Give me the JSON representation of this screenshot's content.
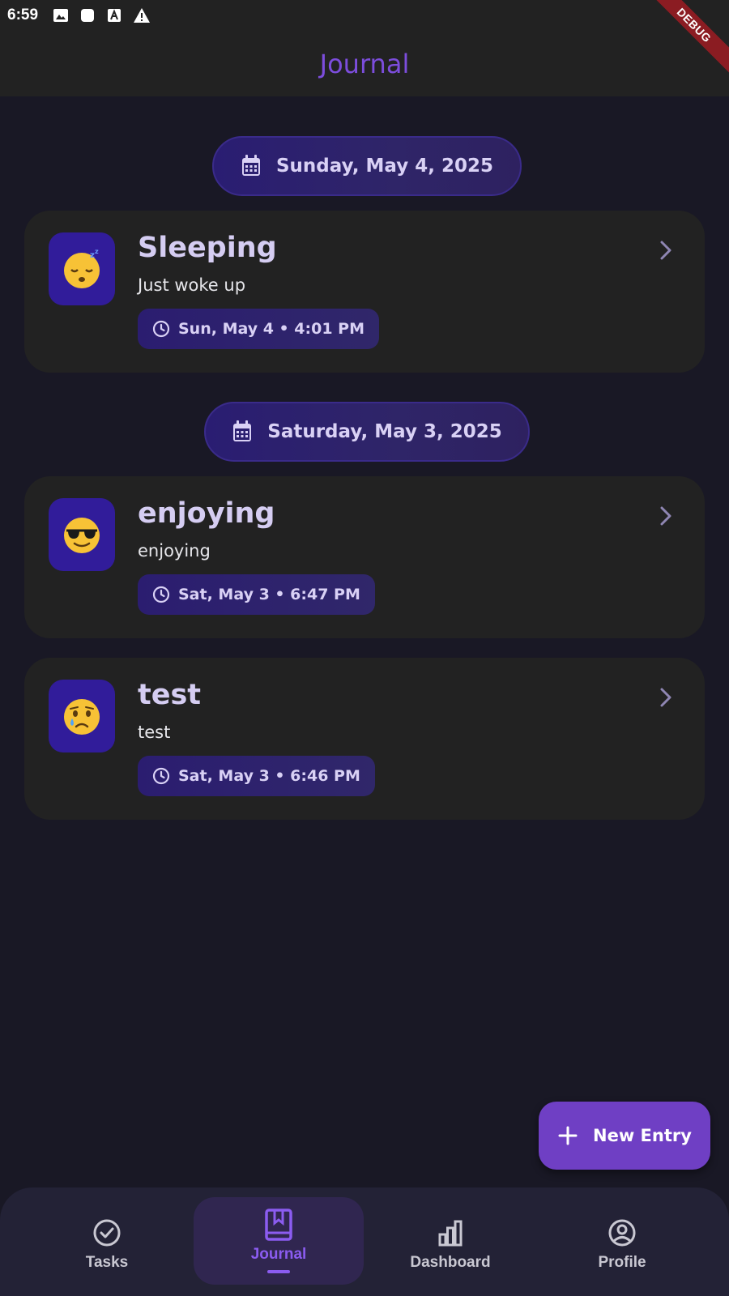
{
  "status_bar": {
    "time": "6:59"
  },
  "debug_banner": "DEBUG",
  "app_bar": {
    "title": "Journal"
  },
  "groups": [
    {
      "date_label": "Sunday, May 4, 2025",
      "entries": [
        {
          "emoji": "sleeping-face",
          "title": "Sleeping",
          "description": "Just woke up",
          "timestamp": "Sun, May 4 • 4:01 PM"
        }
      ]
    },
    {
      "date_label": "Saturday, May 3, 2025",
      "entries": [
        {
          "emoji": "smiling-face-with-sunglasses",
          "title": "enjoying",
          "description": "enjoying",
          "timestamp": "Sat, May 3 • 6:47 PM"
        },
        {
          "emoji": "crying-face",
          "title": "test",
          "description": "test",
          "timestamp": "Sat, May 3 • 6:46 PM"
        }
      ]
    }
  ],
  "fab": {
    "label": "New Entry"
  },
  "bottom_nav": {
    "items": [
      {
        "label": "Tasks",
        "icon": "check-circle-icon"
      },
      {
        "label": "Journal",
        "icon": "journal-bookmark-icon",
        "active": true
      },
      {
        "label": "Dashboard",
        "icon": "bar-chart-icon"
      },
      {
        "label": "Profile",
        "icon": "account-circle-icon"
      }
    ]
  },
  "colors": {
    "accent": "#7c4ddc",
    "background": "#191825",
    "card": "#222222",
    "fab": "#6f3fc4"
  }
}
